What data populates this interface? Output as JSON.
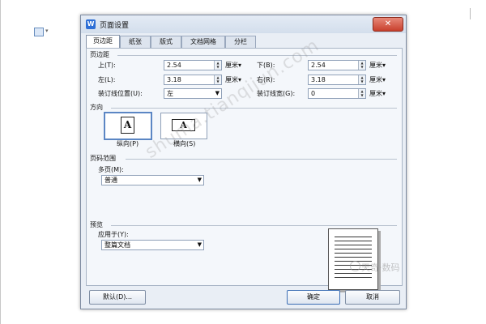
{
  "dialog": {
    "icon_text": "W",
    "title": "页面设置",
    "close_glyph": "✕"
  },
  "tabs": [
    {
      "label": "页边距",
      "active": true
    },
    {
      "label": "纸张",
      "active": false
    },
    {
      "label": "版式",
      "active": false
    },
    {
      "label": "文档网格",
      "active": false
    },
    {
      "label": "分栏",
      "active": false
    }
  ],
  "margins": {
    "section_title": "页边距",
    "top": {
      "label": "上(T):",
      "value": "2.54",
      "unit": "厘米▾"
    },
    "bottom": {
      "label": "下(B):",
      "value": "2.54",
      "unit": "厘米▾"
    },
    "left": {
      "label": "左(L):",
      "value": "3.18",
      "unit": "厘米▾"
    },
    "right": {
      "label": "右(R):",
      "value": "3.18",
      "unit": "厘米▾"
    },
    "gutter_position": {
      "label": "装订线位置(U):",
      "value": "左"
    },
    "gutter_width": {
      "label": "装订线宽(G):",
      "value": "0",
      "unit": "厘米▾"
    }
  },
  "orientation": {
    "section_title": "方向",
    "portrait_label": "纵向(P)",
    "landscape_label": "横向(S)",
    "icon_glyph": "A",
    "selected": "portrait"
  },
  "pages": {
    "section_title": "页码范围",
    "multiple_label": "多页(M):",
    "multiple_value": "普通"
  },
  "preview": {
    "section_title": "预览",
    "apply_label": "应用于(Y):",
    "apply_value": "整篇文档"
  },
  "buttons": {
    "default": "默认(D)...",
    "ok": "确定",
    "cancel": "取消"
  },
  "watermark": {
    "text": "shuma.tianqijun.com",
    "brand": "天奇·数码"
  },
  "colors": {
    "dialog_bg": "#e9eef5",
    "accent": "#5b86c4",
    "close": "#c8402d"
  }
}
